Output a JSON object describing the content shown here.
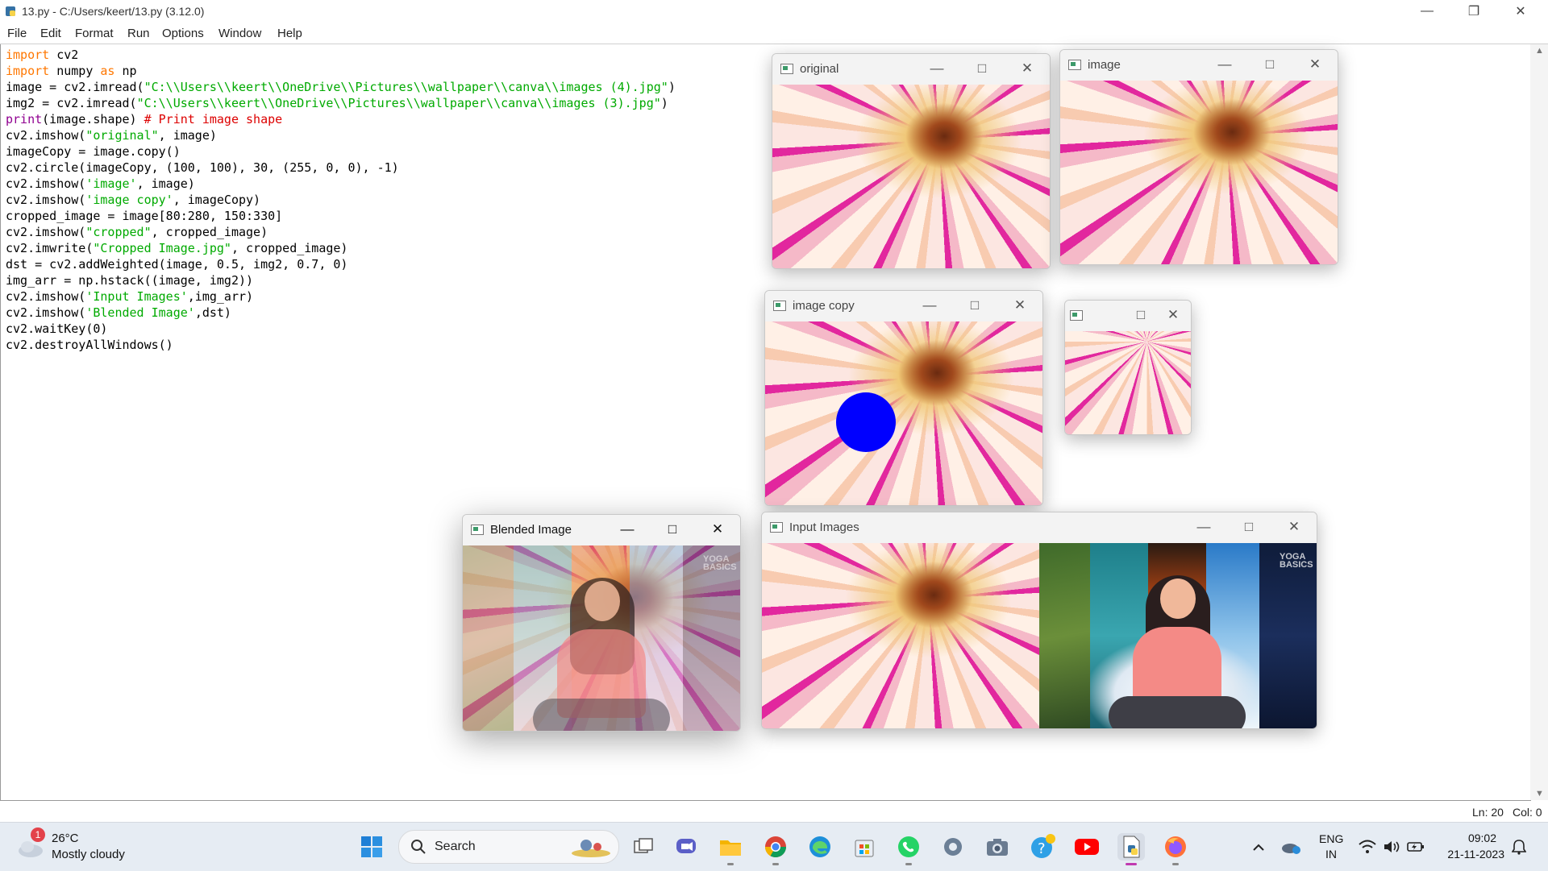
{
  "window": {
    "title": "13.py - C:/Users/keert/13.py (3.12.0)"
  },
  "menu": [
    "File",
    "Edit",
    "Format",
    "Run",
    "Options",
    "Window",
    "Help"
  ],
  "code_lines": [
    [
      {
        "t": "import",
        "c": "kw"
      },
      {
        "t": " cv2",
        "c": ""
      }
    ],
    [
      {
        "t": "import",
        "c": "kw"
      },
      {
        "t": " numpy ",
        "c": ""
      },
      {
        "t": "as",
        "c": "kw"
      },
      {
        "t": " np",
        "c": ""
      }
    ],
    [
      {
        "t": "image = cv2.imread(",
        "c": ""
      },
      {
        "t": "\"C:\\\\Users\\\\keert\\\\OneDrive\\\\Pictures\\\\wallpaper\\\\canva\\\\images (4).jpg\"",
        "c": "st"
      },
      {
        "t": ")",
        "c": ""
      }
    ],
    [
      {
        "t": "img2 = cv2.imread(",
        "c": ""
      },
      {
        "t": "\"C:\\\\Users\\\\keert\\\\OneDrive\\\\Pictures\\\\wallpaper\\\\canva\\\\images (3).jpg\"",
        "c": "st"
      },
      {
        "t": ")",
        "c": ""
      }
    ],
    [
      {
        "t": "print",
        "c": "bi"
      },
      {
        "t": "(image.shape) ",
        "c": ""
      },
      {
        "t": "# Print image shape",
        "c": "cm"
      }
    ],
    [
      {
        "t": "cv2.imshow(",
        "c": ""
      },
      {
        "t": "\"original\"",
        "c": "st"
      },
      {
        "t": ", image)",
        "c": ""
      }
    ],
    [
      {
        "t": "imageCopy = image.copy()",
        "c": ""
      }
    ],
    [
      {
        "t": "cv2.circle(imageCopy, (100, 100), 30, (255, 0, 0), -1)",
        "c": ""
      }
    ],
    [
      {
        "t": "cv2.imshow(",
        "c": ""
      },
      {
        "t": "'image'",
        "c": "st"
      },
      {
        "t": ", image)",
        "c": ""
      }
    ],
    [
      {
        "t": "cv2.imshow(",
        "c": ""
      },
      {
        "t": "'image copy'",
        "c": "st"
      },
      {
        "t": ", imageCopy)",
        "c": ""
      }
    ],
    [
      {
        "t": "cropped_image = image[80:280, 150:330]",
        "c": ""
      }
    ],
    [
      {
        "t": "cv2.imshow(",
        "c": ""
      },
      {
        "t": "\"cropped\"",
        "c": "st"
      },
      {
        "t": ", cropped_image)",
        "c": ""
      }
    ],
    [
      {
        "t": "cv2.imwrite(",
        "c": ""
      },
      {
        "t": "\"Cropped Image.jpg\"",
        "c": "st"
      },
      {
        "t": ", cropped_image)",
        "c": ""
      }
    ],
    [
      {
        "t": "dst = cv2.addWeighted(image, 0.5, img2, 0.7, 0)",
        "c": ""
      }
    ],
    [
      {
        "t": "img_arr = np.hstack((image, img2))",
        "c": ""
      }
    ],
    [
      {
        "t": "cv2.imshow(",
        "c": ""
      },
      {
        "t": "'Input Images'",
        "c": "st"
      },
      {
        "t": ",img_arr)",
        "c": ""
      }
    ],
    [
      {
        "t": "cv2.imshow(",
        "c": ""
      },
      {
        "t": "'Blended Image'",
        "c": "st"
      },
      {
        "t": ",dst)",
        "c": ""
      }
    ],
    [
      {
        "t": "cv2.waitKey(0)",
        "c": ""
      }
    ],
    [
      {
        "t": "cv2.destroyAllWindows()",
        "c": ""
      }
    ]
  ],
  "status": {
    "line": "Ln: 20",
    "col": "Col: 0"
  },
  "cv_windows": {
    "original": "original",
    "image": "image",
    "image_copy": "image copy",
    "cropped": "",
    "blended": "Blended Image",
    "input_images": "Input Images"
  },
  "logo_text": "YOGA BASICS",
  "taskbar": {
    "weather_temp": "26°C",
    "weather_desc": "Mostly cloudy",
    "weather_badge": "1",
    "search_label": "Search",
    "lang_top": "ENG",
    "lang_bottom": "IN",
    "time": "09:02",
    "date": "21-11-2023"
  },
  "colors": {
    "keyword": "#ff7700",
    "string": "#00aa00",
    "builtin": "#900090",
    "comment": "#dd0000",
    "circle": "#0000ff"
  }
}
